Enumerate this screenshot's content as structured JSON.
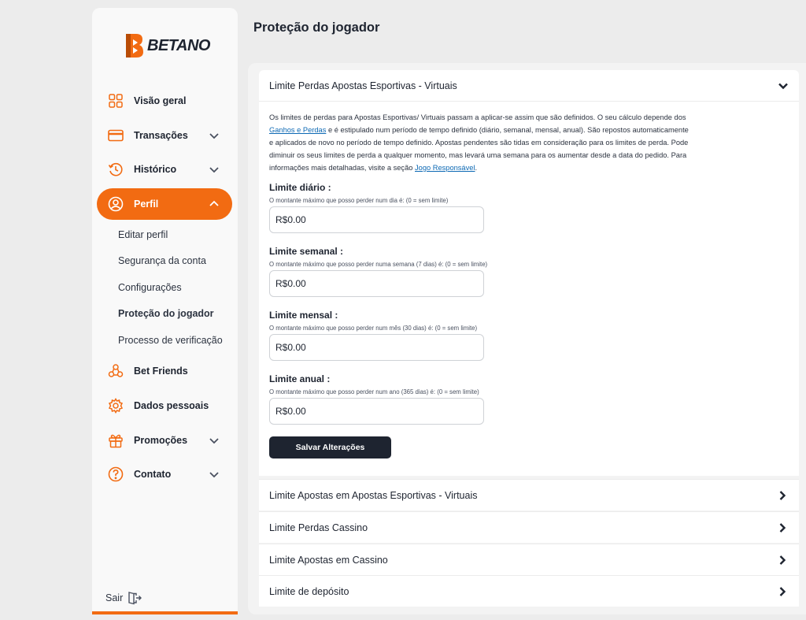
{
  "brand": {
    "name": "BETANO",
    "accent": "#f26b12",
    "dark": "#1e2430",
    "link": "#0d69b4"
  },
  "sidebar": {
    "items": [
      {
        "label": "Visão geral",
        "icon": "grid-icon"
      },
      {
        "label": "Transações",
        "icon": "card-icon"
      },
      {
        "label": "Histórico",
        "icon": "history-icon"
      },
      {
        "label": "Perfil",
        "icon": "user-icon"
      },
      {
        "label": "Bet Friends",
        "icon": "friends-icon"
      },
      {
        "label": "Dados pessoais",
        "icon": "gear-icon"
      },
      {
        "label": "Promoções",
        "icon": "gift-icon"
      },
      {
        "label": "Contato",
        "icon": "help-icon"
      }
    ],
    "sub_items": [
      {
        "label": "Editar perfil"
      },
      {
        "label": "Segurança da conta"
      },
      {
        "label": "Configurações"
      },
      {
        "label": "Proteção do jogador"
      },
      {
        "label": "Processo de verificação"
      }
    ],
    "logout": "Sair"
  },
  "main": {
    "title": "Proteção do jogador",
    "open_section": {
      "title": "Limite Perdas Apostas Esportivas - Virtuais",
      "description_1": "Os limites de perdas para Apostas Esportivas/ Virtuais passam a aplicar-se assim que são definidos. O seu cálculo depende dos ",
      "link_1": "Ganhos e Perdas",
      "description_2": " e é estipulado num período de tempo definido (diário, semanal, mensal, anual). São repostos automaticamente e aplicados de novo no período de tempo definido. Apostas pendentes são tidas em consideração para os limites de perda. Pode diminuir os seus limites de perda a qualquer momento, mas levará uma semana para os aumentar desde a data do pedido. Para informações mais detalhadas, visite a seção ",
      "link_2": "Jogo Responsável",
      "description_3": ".",
      "fields": [
        {
          "label": "Limite diário :",
          "hint": "O montante máximo que posso perder num dia é: (0 = sem limite)",
          "value": "R$0.00"
        },
        {
          "label": "Limite semanal :",
          "hint": "O montante máximo que posso perder numa semana (7 dias) é: (0 = sem limite)",
          "value": "R$0.00"
        },
        {
          "label": "Limite mensal :",
          "hint": "O montante máximo que posso perder num mês (30 dias) é: (0 = sem limite)",
          "value": "R$0.00"
        },
        {
          "label": "Limite anual :",
          "hint": "O montante máximo que posso perder num ano (365 dias) é: (0 = sem limite)",
          "value": "R$0.00"
        }
      ],
      "save_label": "Salvar Alterações"
    },
    "sections": [
      {
        "title": "Limite Apostas em Apostas Esportivas - Virtuais"
      },
      {
        "title": "Limite Perdas Cassino"
      },
      {
        "title": "Limite Apostas em Cassino"
      },
      {
        "title": "Limite de depósito"
      }
    ]
  }
}
